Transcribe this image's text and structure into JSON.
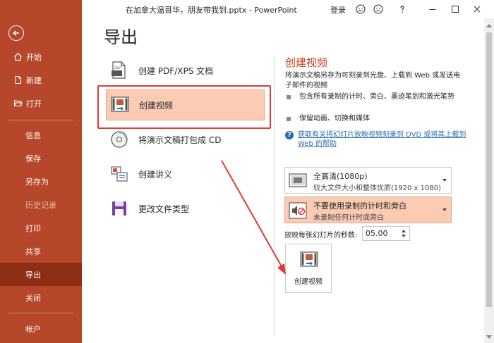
{
  "window": {
    "title": "在加拿大温哥华，朋友带我到.pptx  -  PowerPoint",
    "login": "登录"
  },
  "sidebar": {
    "items": [
      {
        "label": "开始",
        "icon": "home-icon"
      },
      {
        "label": "新建",
        "icon": "new-file-icon"
      },
      {
        "label": "打开",
        "icon": "folder-open-icon"
      },
      {
        "label": "信息"
      },
      {
        "label": "保存"
      },
      {
        "label": "另存为"
      },
      {
        "label": "历史记录"
      },
      {
        "label": "打印"
      },
      {
        "label": "共享"
      },
      {
        "label": "导出"
      },
      {
        "label": "关闭"
      },
      {
        "label": "帐户"
      }
    ]
  },
  "main": {
    "title": "导出",
    "options": [
      {
        "label": "创建 PDF/XPS 文档"
      },
      {
        "label": "创建视频"
      },
      {
        "label": "将演示文稿打包成 CD"
      },
      {
        "label": "创建讲义"
      },
      {
        "label": "更改文件类型"
      }
    ]
  },
  "panel": {
    "title": "创建视频",
    "description": "将演示文稿另存为可刻录到光盘、上载到 Web 或发送电子邮件的视频",
    "bullets": [
      "包含所有录制的计时、旁白、墨迹笔划和激光笔势",
      "保留动画、切换和媒体"
    ],
    "help_link": "获取有关将幻灯片放映视频刻录到 DVD 或将其上载到 Web 的帮助",
    "quality": {
      "title": "全高清(1080p)",
      "subtitle": "较大文件大小和整体优质(1920 x 1080)"
    },
    "timing": {
      "title": "不要使用录制的计时和旁白",
      "subtitle": "未录制任何计时或旁白"
    },
    "seconds_label": "放映每张幻灯片的秒数:",
    "seconds_value": "05.00",
    "create_button": "创建视频"
  },
  "colors": {
    "sidebar_bg": "#b7472a",
    "sidebar_active": "#8e2e15",
    "accent": "#c43e1c",
    "selected_bg": "#fbcbb4",
    "annotation": "#e53935",
    "link": "#2b6cb0"
  }
}
